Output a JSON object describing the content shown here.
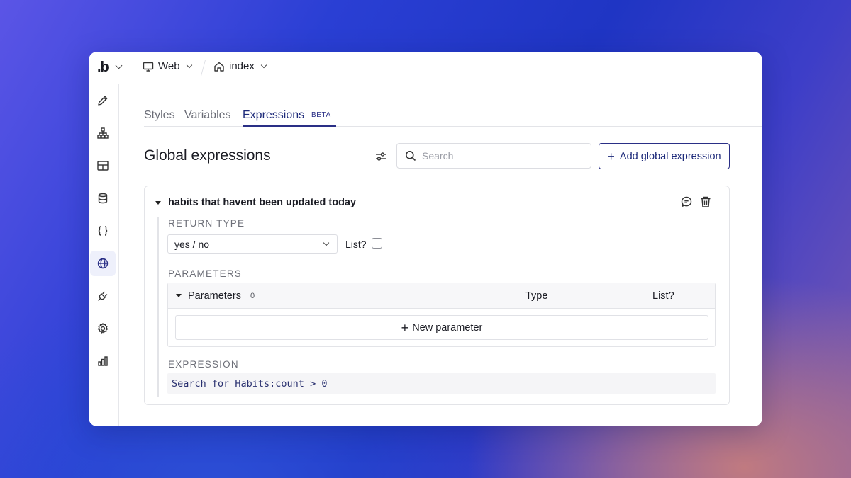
{
  "topbar": {
    "logo_text": ".b",
    "platform_label": "Web",
    "page_label": "index"
  },
  "sidebar": {
    "items": [
      {
        "icon": "pencil-icon"
      },
      {
        "icon": "hierarchy-icon"
      },
      {
        "icon": "layout-icon"
      },
      {
        "icon": "database-icon"
      },
      {
        "icon": "braces-icon"
      },
      {
        "icon": "globe-icon",
        "active": true
      },
      {
        "icon": "plug-icon"
      },
      {
        "icon": "gear-icon"
      },
      {
        "icon": "bar-chart-icon"
      }
    ]
  },
  "tabs": {
    "styles": "Styles",
    "variables": "Variables",
    "expressions": "Expressions",
    "beta": "BETA"
  },
  "header": {
    "title": "Global expressions",
    "search_placeholder": "Search",
    "add_button": "Add global expression"
  },
  "expression_card": {
    "name": "habits that havent been updated today",
    "return_type_label": "RETURN TYPE",
    "return_type_value": "yes / no",
    "list_label": "List?",
    "list_checked": false,
    "parameters_label": "PARAMETERS",
    "parameters_table": {
      "title": "Parameters",
      "count": "0",
      "col_type": "Type",
      "col_list": "List?",
      "new_button": "New parameter"
    },
    "expression_label": "EXPRESSION",
    "expression_value": "Search for Habits:count > 0"
  },
  "colors": {
    "accent": "#2a2f86",
    "text": "#1b1c24",
    "muted": "#6d6f78"
  }
}
